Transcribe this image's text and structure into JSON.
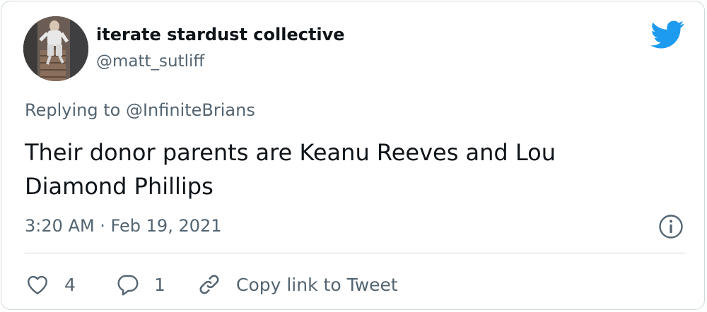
{
  "author": {
    "name": "iterate stardust collective",
    "handle": "@matt_sutliff"
  },
  "reply": {
    "prefix": "Replying to",
    "mention": "@InfiniteBrians"
  },
  "tweet": {
    "text": "Their donor parents are Keanu Reeves and Lou Diamond Phillips",
    "timestamp": "3:20 AM · Feb 19, 2021"
  },
  "actions": {
    "like_count": "4",
    "reply_count": "1",
    "copy_link_label": "Copy link to Tweet"
  },
  "colors": {
    "twitter_blue": "#1d9bf0",
    "secondary_text": "#536471",
    "primary_text": "#0f1419",
    "border": "#cfd9de"
  },
  "icons": [
    "twitter-bird-icon",
    "info-icon",
    "heart-icon",
    "reply-bubble-icon",
    "link-icon"
  ]
}
